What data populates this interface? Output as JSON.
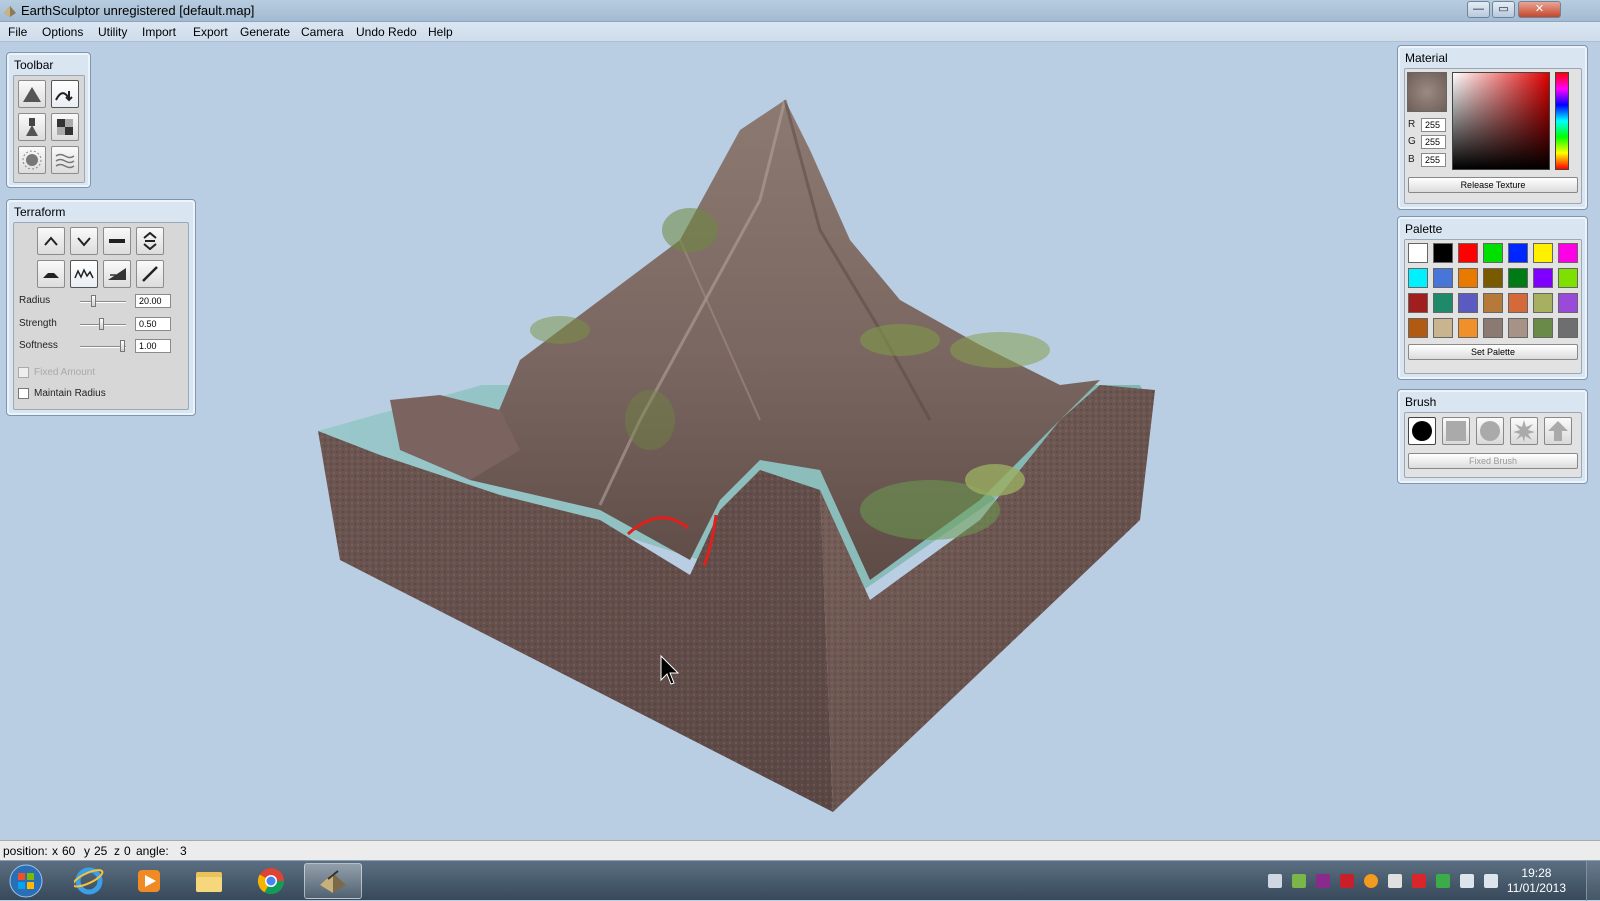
{
  "window": {
    "title": "EarthSculptor unregistered [default.map]",
    "minimize": "—",
    "maximize": "▭",
    "close": "✕"
  },
  "menu": [
    "File",
    "Options",
    "Utility",
    "Import",
    "Export",
    "Generate",
    "Camera",
    "Undo Redo",
    "Help"
  ],
  "toolbar": {
    "title": "Toolbar",
    "tools": [
      "terrain-icon",
      "smooth-terrain-icon",
      "paint-icon",
      "texture-icon",
      "light-icon",
      "water-icon"
    ],
    "selected": "smooth-terrain-icon"
  },
  "terraform": {
    "title": "Terraform",
    "tools": [
      "raise-icon",
      "lower-icon",
      "flatten-icon",
      "dig-icon",
      "plateau-icon",
      "noise-icon",
      "erode-icon",
      "ramp-icon"
    ],
    "selected": "noise-icon",
    "radius": {
      "label": "Radius",
      "value": "20.00",
      "slider": 0.25
    },
    "strength": {
      "label": "Strength",
      "value": "0.50",
      "slider": 0.45
    },
    "softness": {
      "label": "Softness",
      "value": "1.00",
      "slider": 0.95
    },
    "fixed_amount": {
      "label": "Fixed Amount",
      "checked": false,
      "disabled": true
    },
    "maintain_radius": {
      "label": "Maintain Radius",
      "checked": false
    }
  },
  "material": {
    "title": "Material",
    "r_label": "R",
    "g_label": "G",
    "b_label": "B",
    "r": "255",
    "g": "255",
    "b": "255",
    "release_label": "Release Texture"
  },
  "palette": {
    "title": "Palette",
    "colors": [
      "#ffffff",
      "#000000",
      "#ff0000",
      "#00e000",
      "#0026ff",
      "#ffef00",
      "#ff00e6",
      "#00f0ff",
      "#4876d8",
      "#e87a00",
      "#7a5a00",
      "#007a14",
      "#8000ff",
      "#7ee000",
      "#a01e1e",
      "#1e8a6a",
      "#5a5ac0",
      "#b57a3a",
      "#d46a3a",
      "#a7b060",
      "#9a4ad8",
      "#b05a14",
      "#c8b590",
      "#f0902a",
      "#8a7a72",
      "#a69286",
      "#6a8a4a",
      "#6e6e70"
    ],
    "set_label": "Set Palette"
  },
  "brush": {
    "title": "Brush",
    "shapes": [
      "circle-brush-icon",
      "square-brush-icon",
      "soft-circle-brush-icon",
      "splatter-brush-icon",
      "arrow-brush-icon"
    ],
    "fixed_label": "Fixed Brush"
  },
  "status": {
    "position_label": "position:",
    "x_label": "x",
    "x": "60",
    "y_label": "y",
    "y": "25",
    "z_label": "z",
    "z": "0",
    "angle_label": "angle:",
    "angle": "3"
  },
  "taskbar": {
    "apps": [
      "start-orb-icon",
      "internet-explorer-icon",
      "media-player-icon",
      "file-explorer-icon",
      "chrome-icon",
      "earthsculptor-icon"
    ],
    "active": "earthsculptor-icon",
    "time": "19:28",
    "date": "11/01/2013"
  }
}
